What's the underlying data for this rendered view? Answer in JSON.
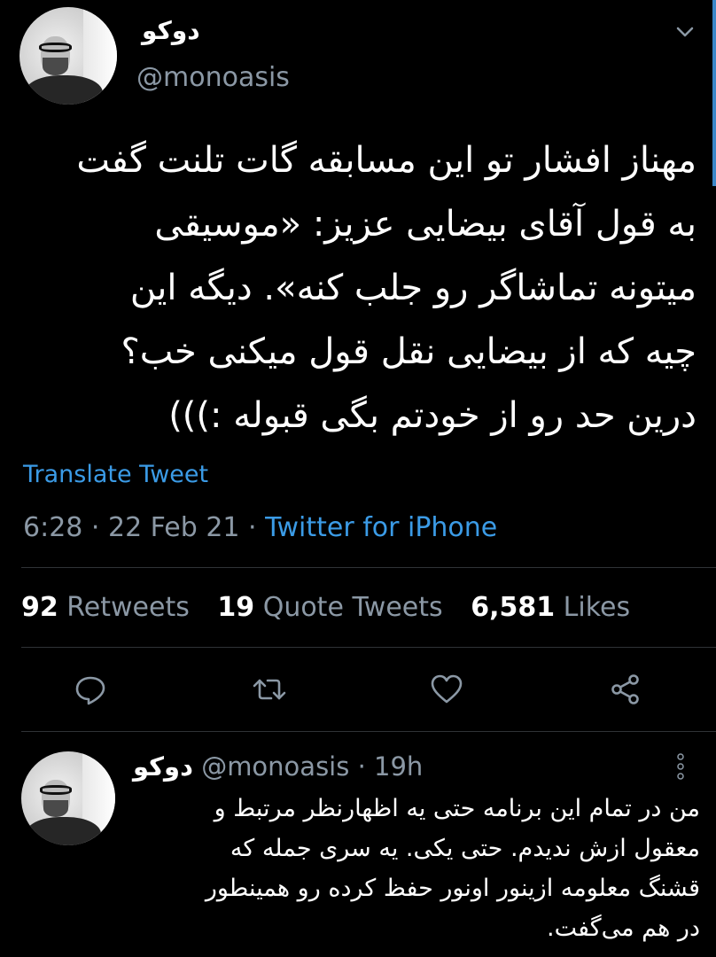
{
  "tweet": {
    "display_name": "دوکو",
    "handle": "@monoasis",
    "text_lines": [
      "مهناز افشار تو این مسابقه گات تلنت گفت",
      "به قول آقای بیضایی عزیز: «موسیقی",
      "میتونه تماشاگر رو جلب کنه». دیگه این",
      "چیه که از بیضایی نقل قول میکنی خب؟",
      "درین حد رو از خودتم بگی قبوله :)))"
    ],
    "translate_label": "Translate Tweet",
    "time_date": "6:28 · 22 Feb 21 · ",
    "client": "Twitter for iPhone"
  },
  "stats": {
    "retweets_count": "92",
    "retweets_label": "Retweets",
    "quotes_count": "19",
    "quotes_label": "Quote Tweets",
    "likes_count": "6,581",
    "likes_label": "Likes"
  },
  "actions": [
    "reply-icon",
    "retweet-icon",
    "like-icon",
    "share-icon"
  ],
  "reply": {
    "display_name": "دوکو",
    "handle": "@monoasis",
    "time": " · 19h",
    "text_lines": [
      "من در تمام این برنامه حتی یه اظهارنظر مرتبط و",
      "معقول ازش ندیدم. حتی یکی. یه سری جمله که",
      "قشنگ معلومه ازینور اونور حفظ کرده رو همینطور",
      "در هم می‌گفت."
    ]
  },
  "colors": {
    "background": "#000000",
    "accent": "#3b9be6",
    "muted": "#8b98a5",
    "text": "#ffffff",
    "divider": "#2f3336"
  }
}
